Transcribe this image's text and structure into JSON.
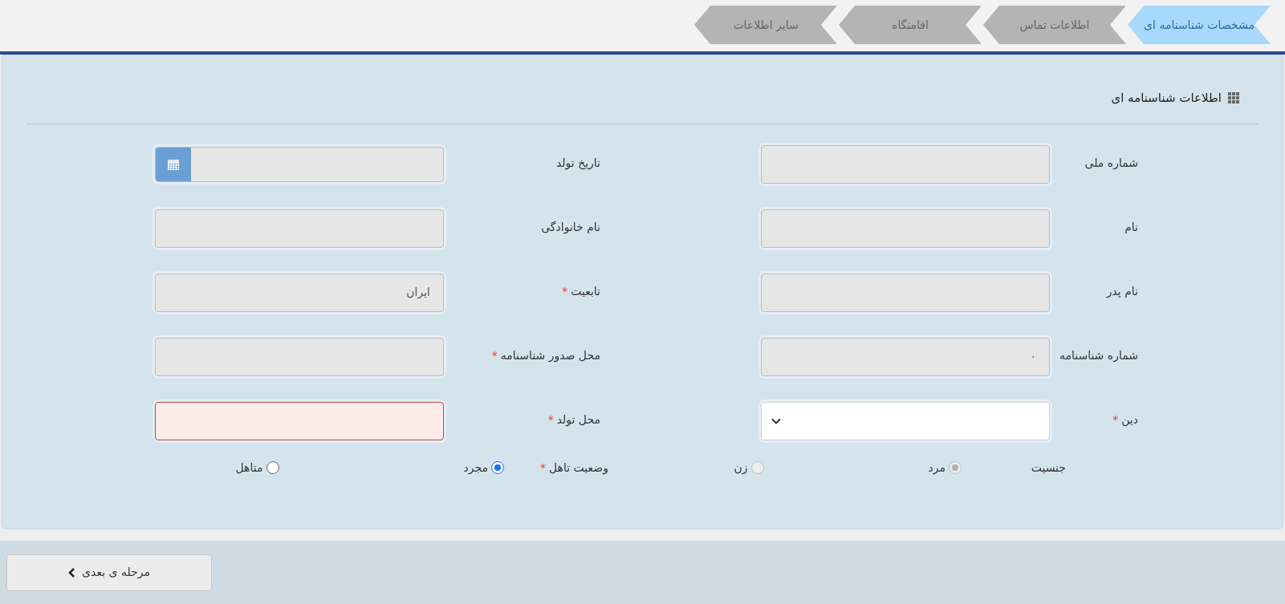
{
  "tabs": [
    {
      "label": "مشخصات شناسنامه ای",
      "selected": true
    },
    {
      "label": "اطلاعات تماس",
      "selected": false
    },
    {
      "label": "اقامتگاه",
      "selected": false
    },
    {
      "label": "سایر اطلاعات",
      "selected": false
    }
  ],
  "panel": {
    "title": "اطلاعات شناسنامه ای",
    "fields": [
      {
        "label": "شماره ملی",
        "kind": "text",
        "disabled": true,
        "invalid": false
      },
      {
        "label": "تاریخ تولد",
        "kind": "date",
        "disabled": true,
        "invalid": false
      },
      {
        "label": "نام",
        "kind": "text",
        "disabled": true,
        "invalid": false
      },
      {
        "label": "نام خانوادگی",
        "kind": "text",
        "disabled": true,
        "invalid": false
      },
      {
        "label": "نام پدر",
        "kind": "text",
        "disabled": true,
        "invalid": false
      },
      {
        "label": "تابعیت",
        "required_mark": "*",
        "kind": "text",
        "disabled": true,
        "invalid": false,
        "value": "ایران"
      },
      {
        "label": "شماره شناسنامه",
        "kind": "text",
        "disabled": true,
        "invalid": false,
        "value": "۰"
      },
      {
        "label": "محل صدور شناسنامه",
        "required_mark": "*",
        "kind": "text",
        "disabled": true,
        "invalid": false
      },
      {
        "label": "دین",
        "required_mark": "*",
        "kind": "select",
        "disabled": false,
        "invalid": false
      },
      {
        "label": "محل تولد",
        "required_mark": "*",
        "kind": "text",
        "disabled": false,
        "invalid": true
      }
    ],
    "radio_groups": [
      {
        "label": "جنسیت",
        "disabled": true,
        "options": [
          {
            "label": "مرد",
            "selected": true
          },
          {
            "label": "زن",
            "selected": false
          }
        ]
      },
      {
        "label": "وضعیت تاهل",
        "required_mark": "*",
        "disabled": false,
        "options": [
          {
            "label": "مجرد",
            "selected": true
          },
          {
            "label": "متاهل",
            "selected": false
          }
        ]
      }
    ]
  },
  "next_button": {
    "label": "مرحله ی بعدی"
  }
}
